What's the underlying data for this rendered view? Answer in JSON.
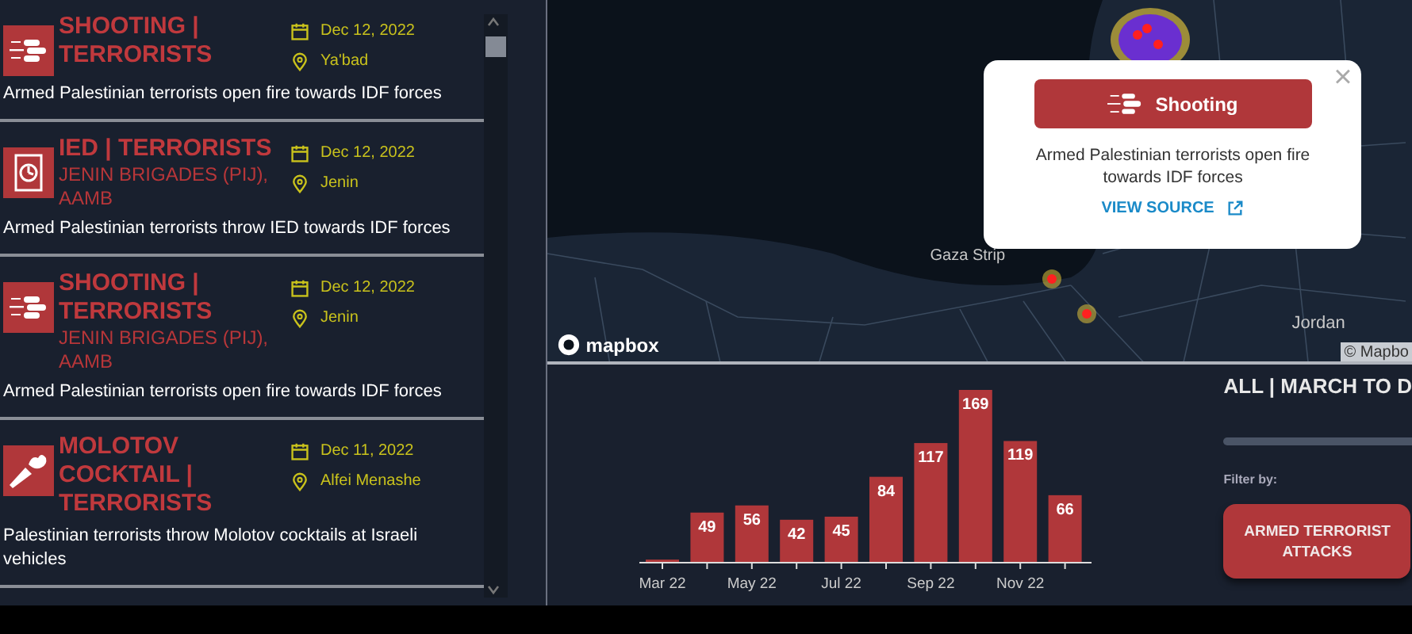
{
  "events": [
    {
      "kind": "shooting",
      "title": "SHOOTING | TERRORISTS",
      "date": "Dec 12, 2022",
      "place": "Ya'bad",
      "description": "Armed Palestinian terrorists open fire towards IDF forces"
    },
    {
      "kind": "ied",
      "title": "IED | TERRORISTS",
      "group": "JENIN BRIGADES (PIJ), AAMB",
      "date": "Dec 12, 2022",
      "place": "Jenin",
      "description": "Armed Palestinian terrorists throw IED towards IDF forces"
    },
    {
      "kind": "shooting",
      "title": "SHOOTING | TERRORISTS",
      "group": "JENIN BRIGADES (PIJ), AAMB",
      "date": "Dec 12, 2022",
      "place": "Jenin",
      "description": "Armed Palestinian terrorists open fire towards IDF forces"
    },
    {
      "kind": "molotov",
      "title": "MOLOTOV COCKTAIL | TERRORISTS",
      "date": "Dec 11, 2022",
      "place": "Alfei Menashe",
      "description": "Palestinian terrorists throw Molotov cocktails at Israeli vehicles"
    }
  ],
  "map": {
    "labels": [
      "Gaza Strip",
      "Jordan"
    ],
    "logo": "mapbox",
    "attribution": "© Mapbo",
    "popup": {
      "close": "×",
      "kind": "shooting",
      "category": "Shooting",
      "description": "Armed Palestinian terrorists open fire towards IDF forces",
      "link": "VIEW SOURCE"
    }
  },
  "chart_data": {
    "type": "bar",
    "values": [
      3,
      49,
      56,
      42,
      45,
      84,
      117,
      169,
      119,
      66
    ],
    "categories": [
      "Mar 22",
      null,
      "May 22",
      null,
      "Jul 22",
      null,
      "Sep 22",
      null,
      "Nov 22",
      null
    ],
    "value_labels": [
      null,
      "49",
      "56",
      "42",
      "45",
      "84",
      "117",
      "169",
      "119",
      "66"
    ]
  },
  "side": {
    "heading": "ALL | MARCH TO D",
    "filter_label": "Filter by:",
    "filter_button": "ARMED TERRORIST ATTACKS"
  }
}
